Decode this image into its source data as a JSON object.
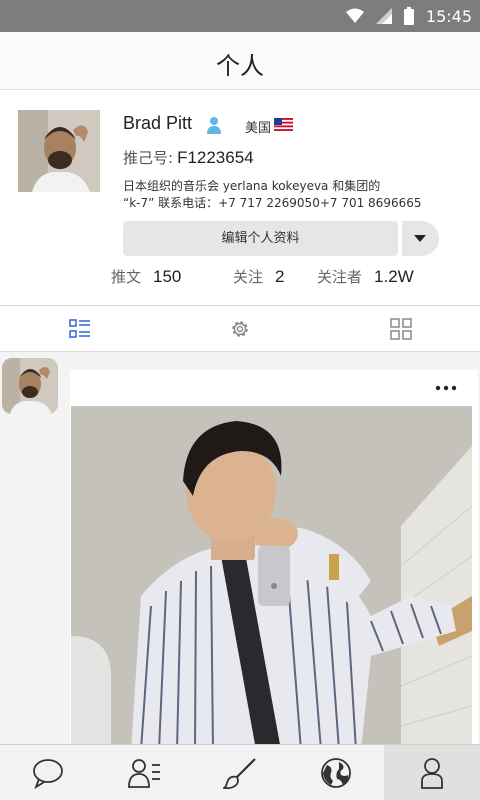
{
  "status_bar": {
    "time": "15:45"
  },
  "header": {
    "title": "个人"
  },
  "profile": {
    "name": "Brad Pitt",
    "country": "美国",
    "id_label": "推己号:",
    "id_value": "F1223654",
    "bio_line1": "日本组织的音乐会 yerlana kokeyeva 和集团的",
    "bio_line2": "“k-7” 联系电话：+7 717 2269050+7 701 8696665",
    "edit_button": "编辑个人资料",
    "stats": [
      {
        "label": "推文",
        "value": "150"
      },
      {
        "label": "关注",
        "value": "2"
      },
      {
        "label": "关注者",
        "value": "1.2W"
      }
    ]
  },
  "tabs": [
    "list-icon",
    "settings-gear-icon",
    "grid-icon"
  ],
  "bottom_nav": [
    "chat-icon",
    "contacts-icon",
    "brush-icon",
    "globe-icon",
    "person-icon"
  ],
  "colors": {
    "accent": "#3d6fd6",
    "status_bar": "#7d7d7d",
    "verified": "#5fb6e8"
  }
}
